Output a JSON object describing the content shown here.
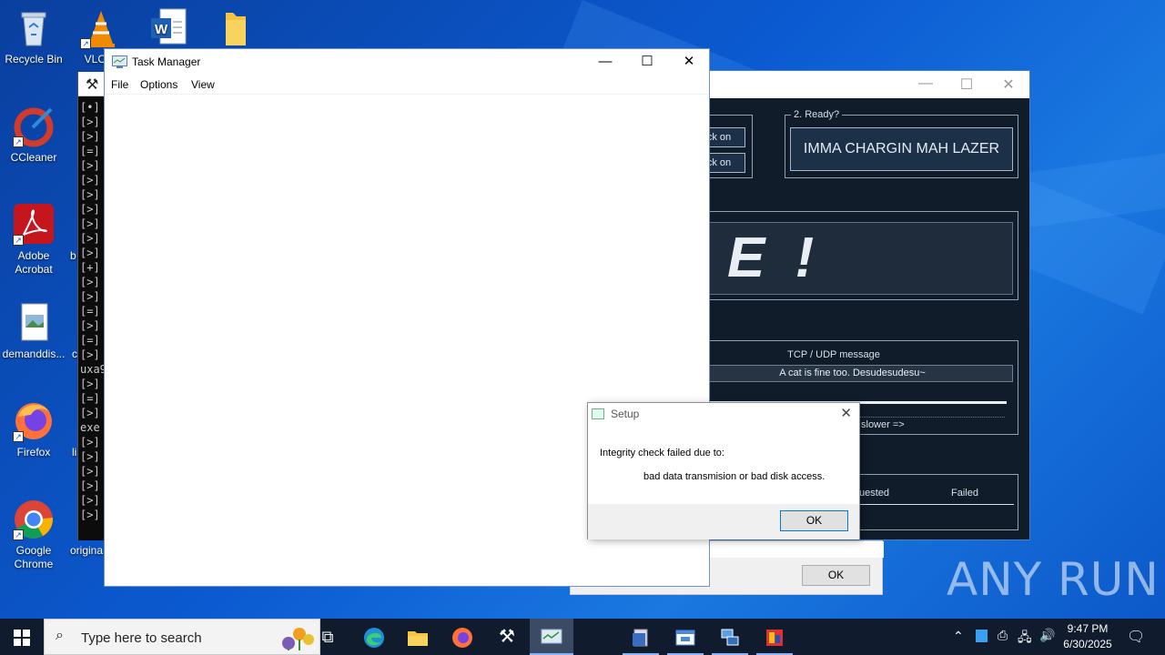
{
  "desktop": {
    "icons": [
      {
        "label": "Recycle Bin"
      },
      {
        "label": "VLC m"
      },
      {
        "label": "CCleaner"
      },
      {
        "label": "Adobe Acrobat"
      },
      {
        "label": "demanddis..."
      },
      {
        "label": "Firefox"
      },
      {
        "label": "Google Chrome"
      }
    ],
    "partial_labels": {
      "b": "b",
      "c": "c",
      "li": "li",
      "origina": "origina"
    }
  },
  "console": {
    "lines": [
      "[•]",
      "[>]",
      "[>]",
      "[=]",
      "[>]",
      "[>]",
      "[>]",
      "[>]",
      "[>]",
      "[>]",
      "[>]",
      "[+]",
      "[>]",
      "[>]",
      "[=]",
      "[>]",
      "[=]",
      "[>]",
      "uxa9",
      "[>]",
      "[=]",
      "[>]",
      "exe",
      "[>]",
      "[>]",
      "[>]",
      "[>]",
      "[>]",
      "[>]"
    ]
  },
  "loic": {
    "ready_label": "2. Ready?",
    "charge_button": "IMMA CHARGIN MAH LAZER",
    "lock_on_1": "ck on",
    "lock_on_2": "ck on",
    "big_text": "E !",
    "tcp_label": "TCP / UDP message",
    "tcp_message": "A cat is fine too. Desudesudesu~",
    "slower_label": "slower =>",
    "requested_header": "uested",
    "failed_header": "Failed"
  },
  "task_manager": {
    "title": "Task Manager",
    "menu": [
      "File",
      "Options",
      "View"
    ]
  },
  "setup_bg": {
    "ok_label": "OK"
  },
  "dialog": {
    "title": "Setup",
    "line1": "Integrity check failed due to:",
    "line2": "bad data transmision or bad disk access.",
    "ok_label": "OK"
  },
  "taskbar": {
    "search_placeholder": "Type here to search",
    "time": "9:47 PM",
    "date": "6/30/2025"
  },
  "watermark": "ANY RUN"
}
